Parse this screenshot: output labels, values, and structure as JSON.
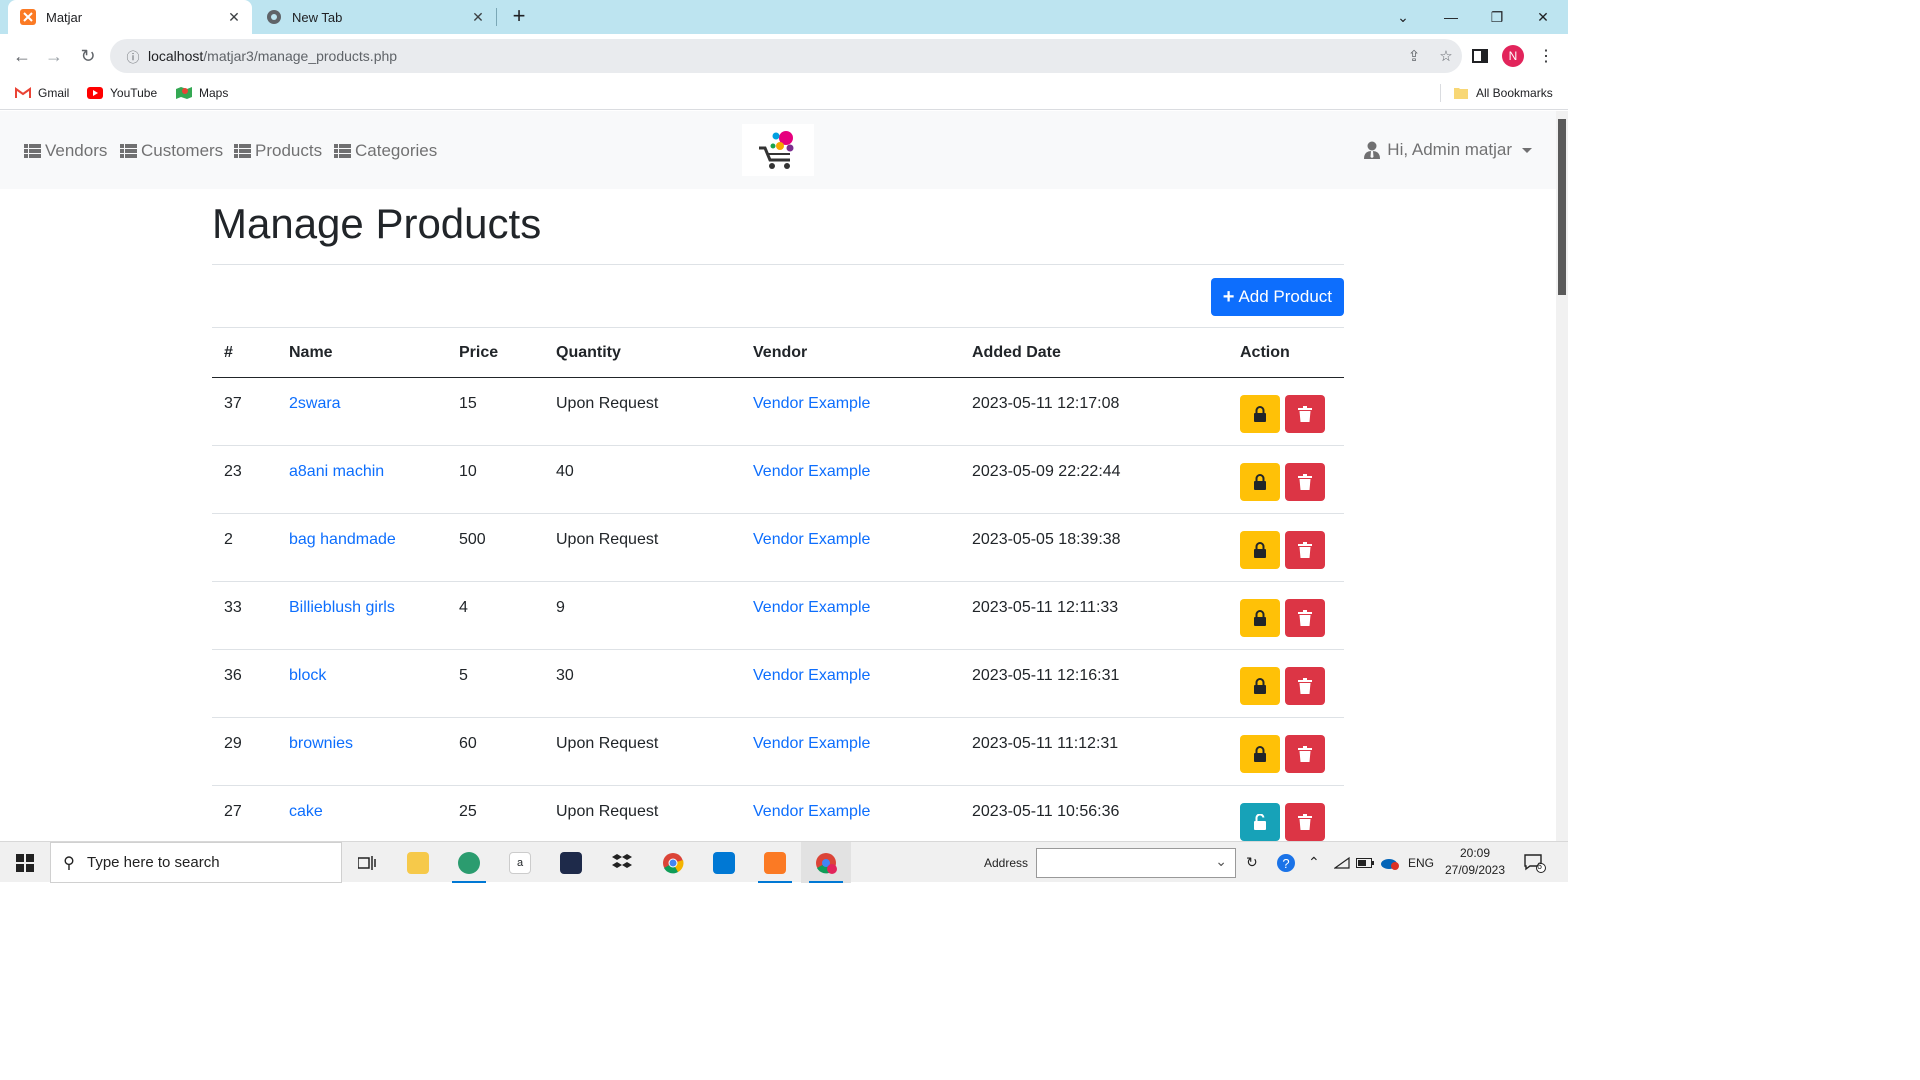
{
  "browser": {
    "tabs": [
      {
        "title": "Matjar",
        "active": true
      },
      {
        "title": "New Tab",
        "active": false
      }
    ],
    "url_host": "localhost",
    "url_path": "/matjar3/manage_products.php",
    "profile_initial": "N",
    "bookmarks": [
      "Gmail",
      "YouTube",
      "Maps"
    ],
    "all_bookmarks": "All Bookmarks"
  },
  "nav": {
    "links": [
      "Vendors",
      "Customers",
      "Products",
      "Categories"
    ],
    "user_greeting": "Hi, Admin matjar"
  },
  "page": {
    "title": "Manage Products",
    "add_button": "Add Product"
  },
  "table": {
    "headers": [
      "#",
      "Name",
      "Price",
      "Quantity",
      "Vendor",
      "Added Date",
      "Action"
    ],
    "rows": [
      {
        "id": "37",
        "name": "2swara",
        "price": "15",
        "quantity": "Upon Request",
        "vendor": "Vendor Example",
        "date": "2023-05-11 12:17:08",
        "lock_state": "locked"
      },
      {
        "id": "23",
        "name": "a8ani machin",
        "price": "10",
        "quantity": "40",
        "vendor": "Vendor Example",
        "date": "2023-05-09 22:22:44",
        "lock_state": "locked"
      },
      {
        "id": "2",
        "name": "bag handmade",
        "price": "500",
        "quantity": "Upon Request",
        "vendor": "Vendor Example",
        "date": "2023-05-05 18:39:38",
        "lock_state": "locked"
      },
      {
        "id": "33",
        "name": "Billieblush girls",
        "price": "4",
        "quantity": "9",
        "vendor": "Vendor Example",
        "date": "2023-05-11 12:11:33",
        "lock_state": "locked"
      },
      {
        "id": "36",
        "name": "block",
        "price": "5",
        "quantity": "30",
        "vendor": "Vendor Example",
        "date": "2023-05-11 12:16:31",
        "lock_state": "locked"
      },
      {
        "id": "29",
        "name": "brownies",
        "price": "60",
        "quantity": "Upon Request",
        "vendor": "Vendor Example",
        "date": "2023-05-11 11:12:31",
        "lock_state": "locked"
      },
      {
        "id": "27",
        "name": "cake",
        "price": "25",
        "quantity": "Upon Request",
        "vendor": "Vendor Example",
        "date": "2023-05-11 10:56:36",
        "lock_state": "unlocked"
      }
    ]
  },
  "taskbar": {
    "search_placeholder": "Type here to search",
    "address_label": "Address",
    "language": "ENG",
    "time": "20:09",
    "date": "27/09/2023",
    "notification_count": "6"
  },
  "colors": {
    "primary": "#0d6efd",
    "warning": "#ffc107",
    "info": "#17a2b8",
    "danger": "#dc3545"
  }
}
